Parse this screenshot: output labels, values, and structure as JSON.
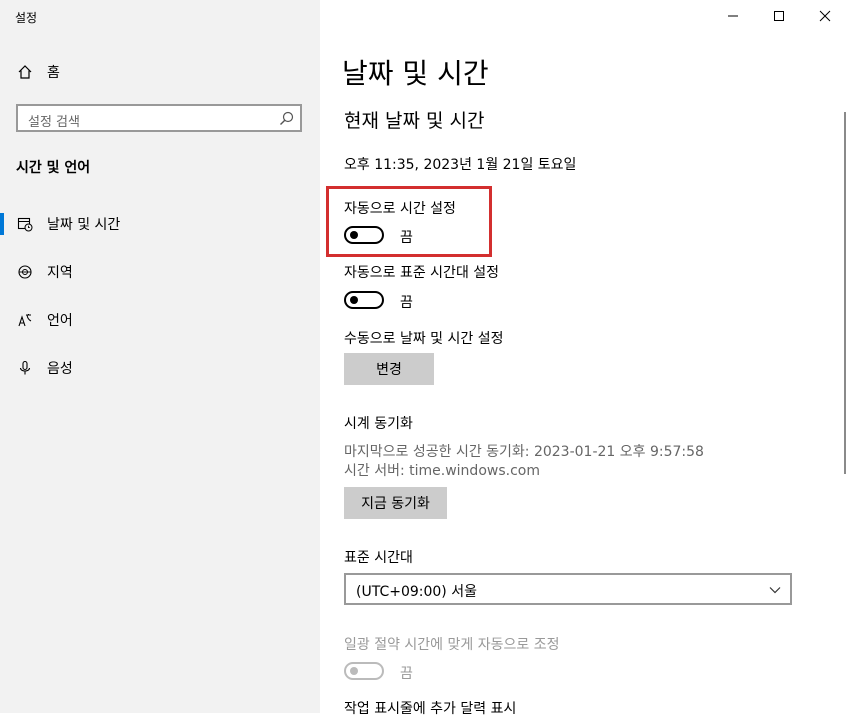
{
  "window": {
    "title": "설정"
  },
  "sidebar": {
    "home_label": "홈",
    "search_placeholder": "설정 검색",
    "section_title": "시간 및 언어",
    "items": [
      {
        "label": "날짜 및 시간",
        "icon": "calendar-clock-icon",
        "selected": true
      },
      {
        "label": "지역",
        "icon": "globe-icon",
        "selected": false
      },
      {
        "label": "언어",
        "icon": "language-icon",
        "selected": false
      },
      {
        "label": "음성",
        "icon": "microphone-icon",
        "selected": false
      }
    ]
  },
  "main": {
    "page_title": "날짜 및 시간",
    "section_title": "현재 날짜 및 시간",
    "current_datetime": "오후 11:35, 2023년 1월 21일 토요일",
    "auto_time": {
      "label": "자동으로 시간 설정",
      "state": "끔"
    },
    "auto_timezone": {
      "label": "자동으로 표준 시간대 설정",
      "state": "끔"
    },
    "manual": {
      "label": "수동으로 날짜 및 시간 설정",
      "button": "변경"
    },
    "sync": {
      "title": "시계 동기화",
      "last_sync": "마지막으로 성공한 시간 동기화: 2023-01-21 오후 9:57:58",
      "server": "시간 서버: time.windows.com",
      "button": "지금 동기화"
    },
    "timezone": {
      "label": "표준 시간대",
      "value": "(UTC+09:00) 서울"
    },
    "dst": {
      "label": "일광 절약 시간에 맞게 자동으로 조정",
      "state": "끔"
    },
    "taskbar_calendar_label": "작업 표시줄에 추가 달력 표시"
  },
  "colors": {
    "accent": "#0078d7",
    "highlight": "#d32f2f",
    "sidebar_bg": "#f2f2f2",
    "button_bg": "#cccccc"
  }
}
